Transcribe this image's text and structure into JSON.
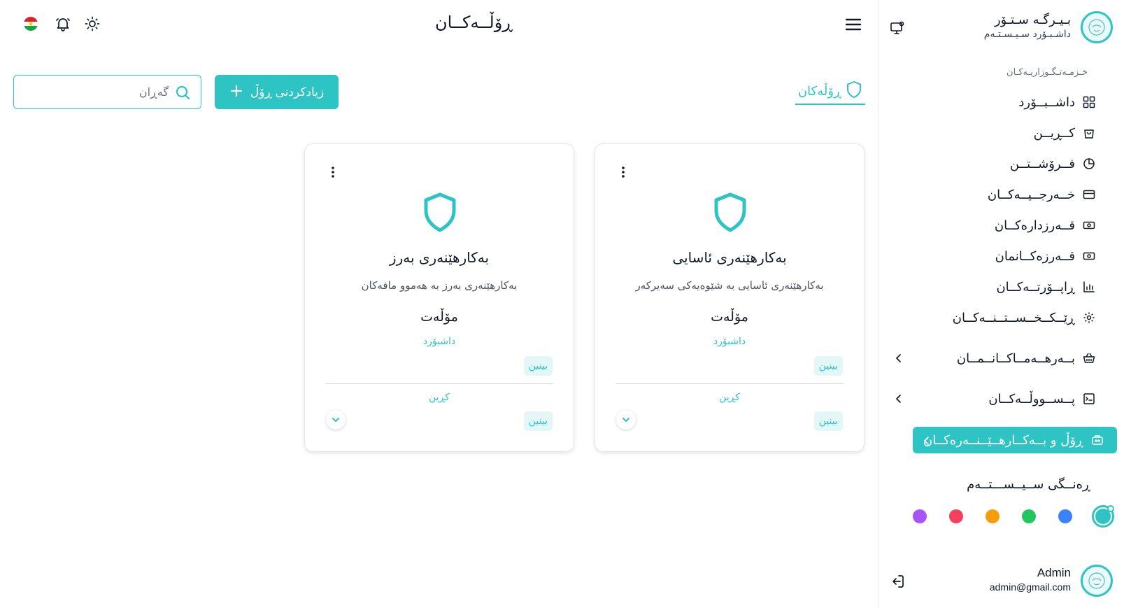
{
  "topbar": {
    "page_title": "ڕۆڵــەکــان"
  },
  "tabs": [
    {
      "label": "ڕۆڵەکان",
      "icon": "shield-icon",
      "active": true
    }
  ],
  "toolbar": {
    "add_button_label": "زیادکردنی ڕۆڵ",
    "search_placeholder": "گەڕان"
  },
  "cards": [
    {
      "title": "بەکارهێنەری ئاسایی",
      "description": "بەکارهێنەری ئاسایی بە شێوەیەکی سەیرکەر",
      "permissions_label": "مۆڵەت",
      "group1": "داشبۆرد",
      "badge1": "بینین",
      "group2": "کڕین",
      "badge2": "بینین"
    },
    {
      "title": "بەکارهێنەری بەرز",
      "description": "بەکارهێنەری بەرز بە هەموو مافەکان",
      "permissions_label": "مۆڵەت",
      "group1": "داشبۆرد",
      "badge1": "بینین",
      "group2": "کڕین",
      "badge2": "بینین"
    }
  ],
  "sidebar": {
    "brand_title": "بـیـرگـە سـتـۆر",
    "brand_subtitle": "داشـبـۆرد سـیـسـتـەم",
    "section_label": "خـزمـەتـگـوزاریـەکـان",
    "items": [
      {
        "label": "داشــبــۆرد",
        "icon": "dashboard-grid-icon"
      },
      {
        "label": "کــڕیــن",
        "icon": "shopping-bag-icon"
      },
      {
        "label": "فــرۆشــتــن",
        "icon": "pie-chart-icon"
      },
      {
        "label": "خــەرجــیــەکــان",
        "icon": "credit-card-icon"
      },
      {
        "label": "قــەرزدارەکــان",
        "icon": "money-icon"
      },
      {
        "label": "قــەرزەکــانمان",
        "icon": "money-icon"
      },
      {
        "label": "ڕاپــۆرتــەکــان",
        "icon": "report-icon"
      },
      {
        "label": "ڕێــکــخــســتــنــەکــان",
        "icon": "settings-icon"
      },
      {
        "label": "بــەرهــەمــاکــانــمــان",
        "icon": "basket-icon",
        "expandable": true
      },
      {
        "label": "پــســووڵــەکــان",
        "icon": "receipt-icon",
        "expandable": true
      },
      {
        "label": "ڕۆڵ و بــەکــارهــێــنــەرەکــان",
        "icon": "users-role-icon",
        "expandable": true,
        "active": true
      }
    ],
    "color_title": "ڕەنــگی ســیــســـتــەم",
    "colors": [
      "#2ec4c4",
      "#3b82f6",
      "#22c55e",
      "#f59e0b",
      "#f43f5e",
      "#a855f7"
    ],
    "selected_color": "#2ec4c4",
    "user": {
      "name": "Admin",
      "email": "admin@gmail.com"
    }
  },
  "accent_color": "#2ec4c4"
}
